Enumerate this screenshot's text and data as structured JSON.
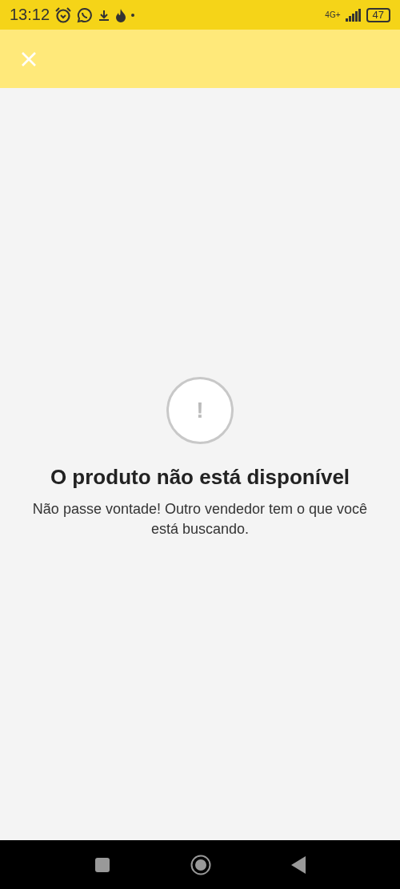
{
  "status_bar": {
    "time": "13:12",
    "network": "4G+",
    "battery": "47"
  },
  "empty_state": {
    "symbol": "!",
    "title": "O produto não está disponível",
    "message": "Não passe vontade! Outro vendedor tem o que você está buscando."
  }
}
